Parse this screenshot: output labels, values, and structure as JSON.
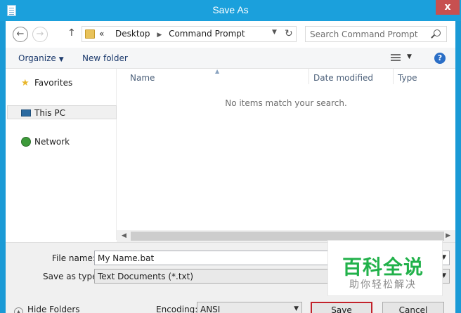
{
  "window": {
    "title": "Save As",
    "close_glyph": "x"
  },
  "navigation": {
    "back_icon": "back-arrow-icon",
    "forward_icon": "forward-arrow-icon",
    "up_icon": "up-arrow-icon",
    "breadcrumb_prefix": "«",
    "breadcrumbs": [
      "Desktop",
      "Command Prompt"
    ],
    "search_placeholder": "Search Command Prompt"
  },
  "toolbar": {
    "organize_label": "Organize",
    "new_folder_label": "New folder"
  },
  "sidebar": {
    "items": [
      {
        "label": "Favorites",
        "icon": "star-icon"
      },
      {
        "label": "This PC",
        "icon": "computer-icon",
        "selected": true
      },
      {
        "label": "Network",
        "icon": "network-icon"
      }
    ]
  },
  "file_list": {
    "columns": [
      "Name",
      "Date modified",
      "Type"
    ],
    "empty_message": "No items match your search."
  },
  "form": {
    "file_name_label": "File name:",
    "file_name_value": "My Name.bat",
    "save_type_label": "Save as type:",
    "save_type_value": "Text Documents (*.txt)",
    "encoding_label": "Encoding:",
    "encoding_value": "ANSI"
  },
  "footer": {
    "hide_folders_label": "Hide Folders",
    "save_label": "Save",
    "cancel_label": "Cancel"
  },
  "watermark": {
    "main": "百科全说",
    "sub": "助你轻松解决"
  },
  "colors": {
    "titlebar": "#1ba0dc",
    "close": "#c75050",
    "save_border": "#c2232b",
    "watermark": "#21b14a"
  }
}
